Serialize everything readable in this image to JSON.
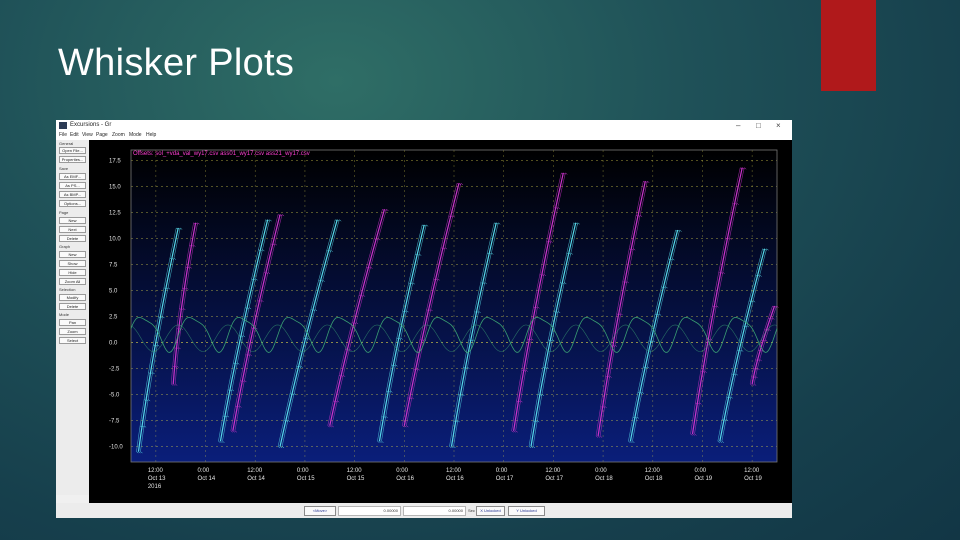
{
  "slide": {
    "title": "Whisker Plots"
  },
  "window": {
    "title": "Excursions - Gr",
    "controls": [
      "–",
      "□",
      "×"
    ],
    "menu": [
      "File",
      "Edit",
      "View",
      "Page",
      "Zoom",
      "Mode",
      "Help"
    ]
  },
  "left_panel": {
    "sections": [
      {
        "label": "General",
        "buttons": [
          "Open File...",
          "Properties..."
        ]
      },
      {
        "label": "Save",
        "buttons": [
          "As EMF...",
          "As PS...",
          "As BMP...",
          "Options..."
        ]
      },
      {
        "label": "Page",
        "buttons": [
          "New",
          "Next",
          "Delete"
        ]
      },
      {
        "label": "Graph",
        "buttons": [
          "New",
          "Show",
          "Hide",
          "Zoom All"
        ]
      },
      {
        "label": "Selection",
        "buttons": [
          "Modify",
          "Delete"
        ]
      },
      {
        "label": "Mode",
        "buttons": [
          "Pan",
          "Zoom",
          "Select"
        ]
      }
    ]
  },
  "bottom_bar": {
    "move_button": "<Move>",
    "field1": "0.00000",
    "field2": "0.00000",
    "unit": "Sec",
    "x_unlocked": "X Unlocked",
    "y_unlocked": "Y Unlocked"
  },
  "chart_data": {
    "type": "line",
    "files_label": "Offsets: sol_+vda_val_wy17.csv ass01_wy17.csv ass21_wy17.csv",
    "ylim": [
      -11.5,
      18.5
    ],
    "yticks": [
      17.5,
      15.0,
      12.5,
      10.0,
      7.5,
      5.0,
      2.5,
      0.0,
      -2.5,
      -5.0,
      -7.5,
      -10.0
    ],
    "ytick_labels": [
      "17.5",
      "15.0",
      "12.5",
      "10.0",
      "7.5",
      "5.0",
      "2.5",
      "0.0",
      "-2.5",
      "-5.0",
      "-7.5",
      "-10.0"
    ],
    "xlim": [
      0,
      13
    ],
    "xticks": [
      {
        "t": 0.5,
        "label": "12:00",
        "date": "Oct 13",
        "year": "2016"
      },
      {
        "t": 1.5,
        "label": "0:00",
        "date": "Oct 14"
      },
      {
        "t": 2.5,
        "label": "12:00",
        "date": "Oct 14"
      },
      {
        "t": 3.5,
        "label": "0:00",
        "date": "Oct 15"
      },
      {
        "t": 4.5,
        "label": "12:00",
        "date": "Oct 15"
      },
      {
        "t": 5.5,
        "label": "0:00",
        "date": "Oct 16"
      },
      {
        "t": 6.5,
        "label": "12:00",
        "date": "Oct 16"
      },
      {
        "t": 7.5,
        "label": "0:00",
        "date": "Oct 17"
      },
      {
        "t": 8.5,
        "label": "12:00",
        "date": "Oct 17"
      },
      {
        "t": 9.5,
        "label": "0:00",
        "date": "Oct 18"
      },
      {
        "t": 10.5,
        "label": "12:00",
        "date": "Oct 18"
      },
      {
        "t": 11.5,
        "label": "0:00",
        "date": "Oct 19"
      },
      {
        "t": 12.5,
        "label": "12:00",
        "date": "Oct 19"
      }
    ],
    "colors": {
      "background_top": "#000000",
      "background_bottom": "#0a1e7a",
      "grid": "#c9c34a"
    },
    "series": [
      {
        "color": "#56d8e8",
        "style": "whisker",
        "segments": [
          {
            "t0": 0.15,
            "y0": -10.5,
            "t1": 0.95,
            "y1": 11.0
          },
          {
            "t0": 1.8,
            "y0": -9.5,
            "t1": 2.75,
            "y1": 11.8
          },
          {
            "t0": 3.0,
            "y0": -10.0,
            "t1": 4.15,
            "y1": 11.8
          },
          {
            "t0": 5.0,
            "y0": -9.5,
            "t1": 5.9,
            "y1": 11.3
          },
          {
            "t0": 6.45,
            "y0": -10.0,
            "t1": 7.35,
            "y1": 11.5
          },
          {
            "t0": 8.05,
            "y0": -10.0,
            "t1": 8.95,
            "y1": 11.5
          },
          {
            "t0": 10.05,
            "y0": -9.5,
            "t1": 11.0,
            "y1": 10.8
          },
          {
            "t0": 11.85,
            "y0": -9.5,
            "t1": 12.75,
            "y1": 9.0
          }
        ]
      },
      {
        "color": "#cc33cc",
        "style": "whisker",
        "segments": [
          {
            "t0": 0.85,
            "y0": -4.0,
            "t1": 1.3,
            "y1": 11.5
          },
          {
            "t0": 2.05,
            "y0": -8.5,
            "t1": 3.0,
            "y1": 12.3
          },
          {
            "t0": 4.0,
            "y0": -8.0,
            "t1": 5.1,
            "y1": 12.8
          },
          {
            "t0": 5.5,
            "y0": -8.0,
            "t1": 6.6,
            "y1": 15.3
          },
          {
            "t0": 7.7,
            "y0": -8.5,
            "t1": 8.7,
            "y1": 16.3
          },
          {
            "t0": 9.4,
            "y0": -9.0,
            "t1": 10.35,
            "y1": 15.5
          },
          {
            "t0": 11.3,
            "y0": -8.8,
            "t1": 12.3,
            "y1": 16.8
          },
          {
            "t0": 12.5,
            "y0": -4.0,
            "t1": 12.95,
            "y1": 3.5
          }
        ]
      },
      {
        "color": "#3fae78",
        "style": "wave",
        "period": 1.0,
        "amplitude": 1.6,
        "offset": 1.0
      }
    ]
  }
}
